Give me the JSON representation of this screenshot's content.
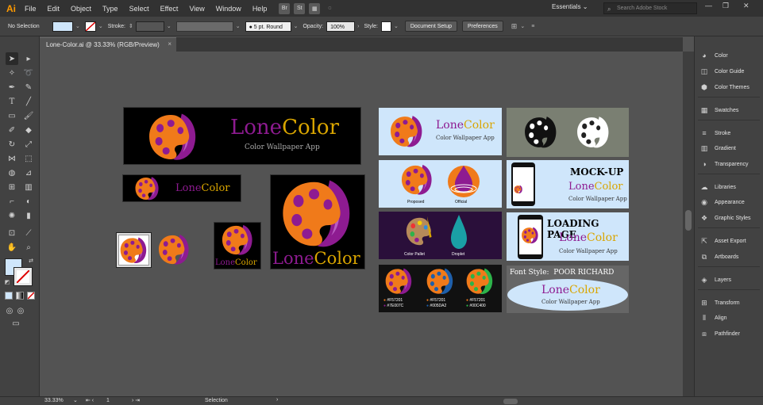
{
  "app": {
    "logo": "Ai"
  },
  "menu": [
    "File",
    "Edit",
    "Object",
    "Type",
    "Select",
    "Effect",
    "View",
    "Window",
    "Help"
  ],
  "menubar_icons": [
    "Br",
    "St"
  ],
  "workspace": "Essentials",
  "stock_search": {
    "placeholder": "Search Adobe Stock"
  },
  "control": {
    "selection": "No Selection",
    "stroke_label": "Stroke:",
    "brush": "5 pt. Round",
    "opacity_label": "Opacity:",
    "opacity": "100%",
    "style_label": "Style:",
    "doc_setup": "Document Setup",
    "preferences": "Preferences"
  },
  "document": {
    "tab_title": "Lone-Color.ai @ 33.33% (RGB/Preview)",
    "close": "×"
  },
  "brand": {
    "lone": "Lone",
    "color": "Color",
    "tagline": "Color Wallpaper App"
  },
  "art": {
    "proposed": "Proposed",
    "official": "Official",
    "color_pallet": "Color Pallet",
    "droplet": "Droplet",
    "mockup": "MOCK-UP",
    "loading": "LOADING PAGE",
    "font_style_label": "Font Style:",
    "font_style": "POOR RICHARD",
    "hex": [
      "#F57201",
      "#F57201",
      "#F57201",
      "#7E007C",
      "#005DA2",
      "#00C400"
    ]
  },
  "colors": {
    "orange": "#f07a1a",
    "purple": "#8e1b91",
    "blue": "#1f5faa",
    "green": "#2db34a",
    "teal": "#1aa0a5",
    "gold_text": "#d9a500"
  },
  "panels": [
    {
      "label": "Color",
      "icon": "color-icon"
    },
    {
      "label": "Color Guide",
      "icon": "color-guide-icon"
    },
    {
      "label": "Color Themes",
      "icon": "color-themes-icon"
    },
    {
      "label": "Swatches",
      "icon": "swatches-icon"
    },
    {
      "label": "Stroke",
      "icon": "stroke-icon"
    },
    {
      "label": "Gradient",
      "icon": "gradient-icon"
    },
    {
      "label": "Transparency",
      "icon": "transparency-icon"
    },
    {
      "label": "Libraries",
      "icon": "libraries-icon"
    },
    {
      "label": "Appearance",
      "icon": "appearance-icon"
    },
    {
      "label": "Graphic Styles",
      "icon": "graphic-styles-icon"
    },
    {
      "label": "Asset Export",
      "icon": "asset-export-icon"
    },
    {
      "label": "Artboards",
      "icon": "artboards-icon"
    },
    {
      "label": "Layers",
      "icon": "layers-icon"
    },
    {
      "label": "Transform",
      "icon": "transform-icon"
    },
    {
      "label": "Align",
      "icon": "align-icon"
    },
    {
      "label": "Pathfinder",
      "icon": "pathfinder-icon"
    }
  ],
  "status": {
    "zoom": "33.33%",
    "artboard": "1",
    "mode": "Selection"
  }
}
